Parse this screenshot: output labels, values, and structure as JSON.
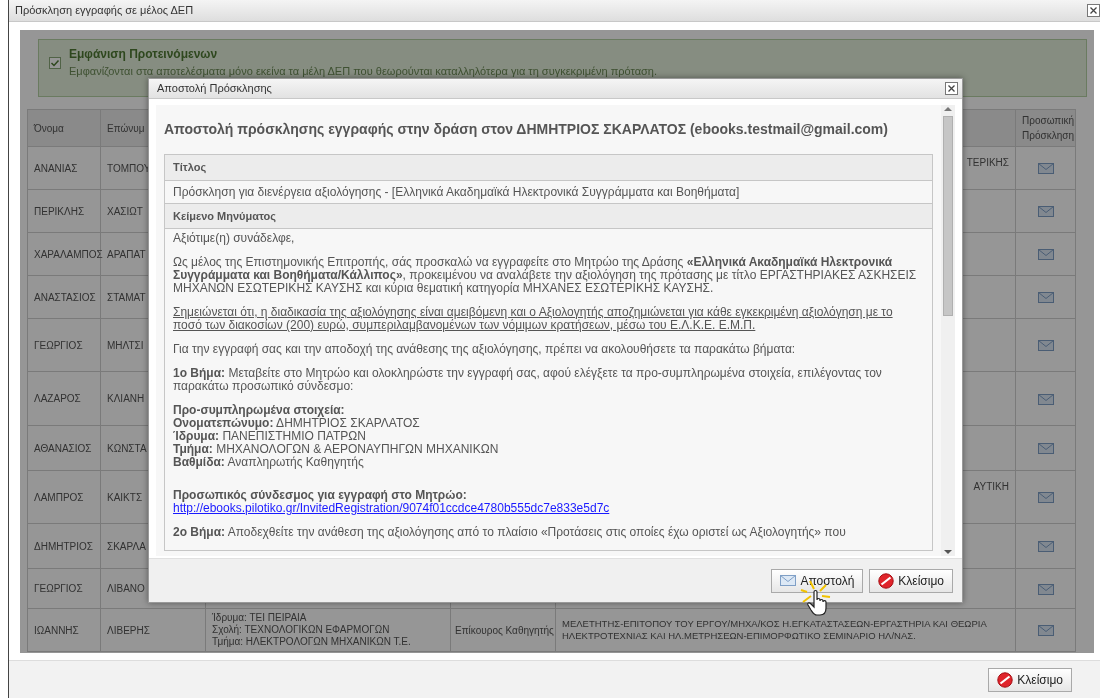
{
  "window": {
    "title": "Πρόσκληση εγγραφής σε μέλος ΔΕΠ"
  },
  "suggested_filter": {
    "checked": true,
    "label": "Εμφάνιση Προτεινόμενων",
    "description": "Εμφανίζονται στα αποτελέσματα μόνο εκείνα τα μέλη ΔΕΠ που θεωρούνται καταλληλότερα για τη συγκεκριμένη πρόταση."
  },
  "members_table": {
    "columns": {
      "first_name": "Όνομα",
      "last_name": "Επώνυμ",
      "invitation": "Προσωπική Πρόσκληση"
    },
    "rows": [
      {
        "first_name": "ΑΝΑΝΙΑΣ",
        "last_name": "ΤΟΜΠΟΥ",
        "subject": "ΤΕΡΙΚΗΣ",
        "subject_cut": true
      },
      {
        "first_name": "ΠΕΡΙΚΛΗΣ",
        "last_name": "ΧΑΣΙΩΤ"
      },
      {
        "first_name": "ΧΑΡΑΛΑΜΠΟΣ",
        "last_name": "ΑΡΑΠΑΤ"
      },
      {
        "first_name": "ΑΝΑΣΤΑΣΙΟΣ",
        "last_name": "ΣΤΑΜΑΤ"
      },
      {
        "first_name": "ΓΕΩΡΓΙΟΣ",
        "last_name": "ΜΗΛΤΣΙ"
      },
      {
        "first_name": "ΛΑΖΑΡΟΣ",
        "last_name": "ΚΛΙΑΝΗ"
      },
      {
        "first_name": "ΑΘΑΝΑΣΙΟΣ",
        "last_name": "ΚΩΝΣΤΑ"
      },
      {
        "first_name": "ΛΑΜΠΡΟΣ",
        "last_name": "ΚΑΙΚΤΣ",
        "subject": "ΑΥΤΙΚΗ",
        "subject_cut": true
      },
      {
        "first_name": "ΔΗΜΗΤΡΙΟΣ",
        "last_name": "ΣΚΑΡΛΑ"
      },
      {
        "first_name": "ΓΕΩΡΓΙΟΣ",
        "last_name": "ΛΙΒΑΝΟ"
      },
      {
        "first_name": "ΙΩΑΝΝΗΣ",
        "last_name": "ΛΙΒΕΡΗΣ",
        "institution": [
          "Ίδρυμα: ΤΕΙ ΠΕΙΡΑΙΑ",
          "Σχολή: ΤΕΧΝΟΛΟΓΙΚΩΝ ΕΦΑΡΜΟΓΩΝ",
          "Τμήμα: ΗΛΕΚΤΡΟΛΟΓΩΝ ΜΗΧΑΝΙΚΩΝ Τ.Ε."
        ],
        "rank": "Επίκουρος Καθηγητής",
        "subject": "ΜΕΛΕΤΗΤΗΣ-ΕΠΙΤΟΠΟΥ ΤΟΥ ΕΡΓΟΥ/ΜΗΧΑ/ΚΟΣ Η.ΕΓΚΑΤΑΣΤΑΣΕΩΝ-ΕΡΓΑΣΤΗΡΙΑ ΚΑΙ ΘΕΩΡΙΑ ΗΛΕΚΤΡΟΤΕΧΝΙΑΣ ΚΑΙ ΗΛ.ΜΕΤΡΗΣΕΩΝ-ΕΠΙΜΟΡΦΩΤΙΚΟ ΣΕΜΙΝΑΡΙΟ ΗΛ/ΝΑΣ.",
        "subject_cut": false
      }
    ]
  },
  "dialog": {
    "title": "Αποστολή Πρόσκλησης",
    "heading": "Αποστολή πρόσκλησης εγγραφής στην δράση στον ΔΗΜΗΤΡΙΟΣ ΣΚΑΡΛΑΤΟΣ (ebooks.testmail@gmail.com)",
    "sections": [
      {
        "kind": "header",
        "text": "Τίτλος"
      },
      {
        "kind": "value",
        "text": "Πρόσκληση για διενέργεια αξιολόγησης - [Ελληνικά Ακαδημαϊκά Ηλεκτρονικά Συγγράμματα και Βοηθήματα]"
      },
      {
        "kind": "header",
        "text": "Κείμενο Μηνύματος"
      }
    ],
    "message": [
      {
        "kind": "text",
        "text": "Αξιότιμε(η) συνάδελφε,"
      },
      {
        "kind": "text",
        "text": "Ως μέλος της Επιστημονικής Επιτροπής, σάς προσκαλώ να εγγραφείτε στο Μητρώο της Δράσης **«Ελληνικά Ακαδημαϊκά Ηλεκτρονικά Συγγράμματα και Βοηθήματα/Κάλλιπος»**, προκειμένου να αναλάβετε την αξιολόγηση της πρότασης με τίτλο ΕΡΓΑΣΤΗΡΙΑΚΕΣ ΑΣΚΗΣΕΙΣ ΜΗΧΑΝΩΝ ΕΣΩΤΕΡΙΚΗΣ ΚΑΥΣΗΣ και κύρια θεματική κατηγορία ΜΗΧΑΝΕΣ ΕΣΩΤΕΡΙΚΗΣ ΚΑΥΣΗΣ."
      },
      {
        "kind": "underlined",
        "text": "Σημειώνεται ότι, η διαδικασία της αξιολόγησης είναι αμειβόμενη και ο Αξιολογητής αποζημιώνεται για κάθε εγκεκριμένη αξιολόγηση με το ποσό των διακοσίων (200) ευρώ, συμπεριλαμβανομένων των νόμιμων κρατήσεων, μέσω του Ε.Λ.Κ.Ε. Ε.Μ.Π."
      },
      {
        "kind": "text",
        "text": "Για την εγγραφή σας και την αποδοχή της ανάθεσης της αξιολόγησης, πρέπει να ακολουθήσετε τα παρακάτω βήματα:"
      },
      {
        "kind": "step",
        "label": "1ο Βήμα:",
        "text": "Μεταβείτε στο Μητρώο και ολοκληρώστε την εγγραφή σας, αφού ελέγξετε τα προ-συμπληρωμένα στοιχεία, επιλέγοντας τον παρακάτω προσωπικό σύνδεσμο:"
      },
      {
        "kind": "fields",
        "heading": "Προ-συμπληρωμένα στοιχεία:",
        "fields": [
          {
            "label": "Ονοματεπώνυμο:",
            "value": "ΔΗΜΗΤΡΙΟΣ ΣΚΑΡΛΑΤΟΣ"
          },
          {
            "label": "Ίδρυμα:",
            "value": "ΠΑΝΕΠΙΣΤΗΜΙΟ ΠΑΤΡΩΝ"
          },
          {
            "label": "Τμήμα:",
            "value": "ΜΗΧΑΝΟΛΟΓΩΝ & ΑΕΡΟΝΑΥΠΗΓΩΝ ΜΗΧΑΝΙΚΩΝ"
          },
          {
            "label": "Βαθμίδα:",
            "value": "Αναπληρωτής Καθηγητής"
          }
        ]
      },
      {
        "kind": "link",
        "heading": "Προσωπικός σύνδεσμος για εγγραφή στο Μητρώο:",
        "url": "http://ebooks.pilotiko.gr/InvitedRegistration/9074f01ccdce4780b555dc7e833e5d7c"
      },
      {
        "kind": "step",
        "label": "2ο Βήμα:",
        "text": "Αποδεχθείτε την ανάθεση της αξιολόγησης από το πλαίσιο «Προτάσεις στις οποίες έχω οριστεί ως Αξιολογητής» που"
      }
    ],
    "buttons": [
      {
        "kind": "send",
        "label": "Αποστολή"
      },
      {
        "kind": "close",
        "label": "Κλείσιμο"
      }
    ]
  },
  "footer": {
    "buttons": [
      {
        "kind": "close",
        "label": "Κλείσιμο"
      }
    ]
  }
}
